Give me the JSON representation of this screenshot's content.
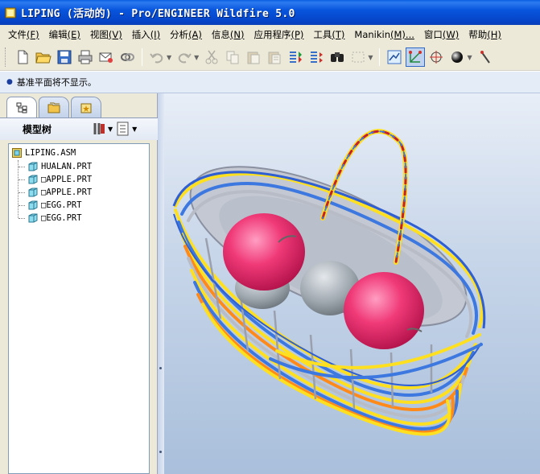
{
  "window": {
    "title": "LIPING (活动的) - Pro/ENGINEER Wildfire 5.0"
  },
  "menu": [
    {
      "label": "文件",
      "key": "(F)"
    },
    {
      "label": "编辑",
      "key": "(E)"
    },
    {
      "label": "视图",
      "key": "(V)"
    },
    {
      "label": "插入",
      "key": "(I)"
    },
    {
      "label": "分析",
      "key": "(A)"
    },
    {
      "label": "信息",
      "key": "(N)"
    },
    {
      "label": "应用程序",
      "key": "(P)"
    },
    {
      "label": "工具",
      "key": "(T)"
    },
    {
      "label": "Manikin",
      "key": "(M)..."
    },
    {
      "label": "窗口",
      "key": "(W)"
    },
    {
      "label": "帮助",
      "key": "(H)"
    }
  ],
  "message": {
    "text": "基准平面将不显示。"
  },
  "model_tree": {
    "header": "模型树",
    "root": "LIPING.ASM",
    "children": [
      "HUALAN.PRT",
      "□APPLE.PRT",
      "□APPLE.PRT",
      "□EGG.PRT",
      "□EGG.PRT"
    ]
  },
  "colors": {
    "titlebar": "#0a4fd6",
    "apple": "#e8306a",
    "egg": "#a9b1b8",
    "basket_yellow": "#ffe020",
    "basket_blue": "#3c78e0",
    "basket_orange": "#ff8a1a",
    "basket_gray": "#b8bcc6"
  }
}
